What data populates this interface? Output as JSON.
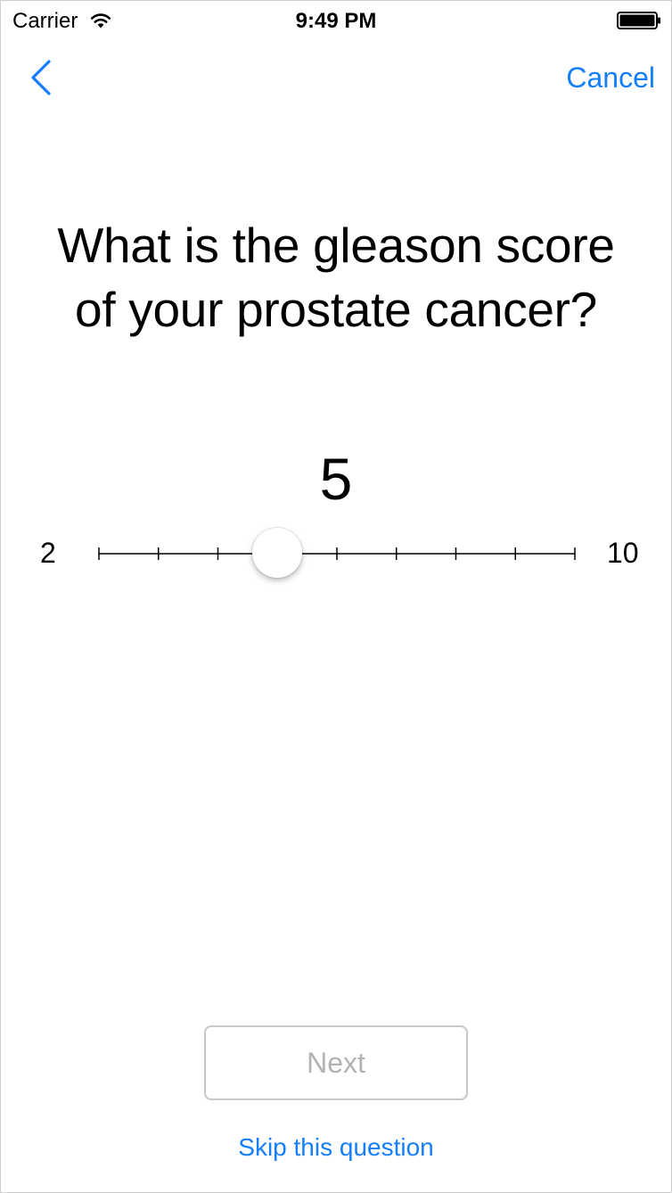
{
  "status_bar": {
    "carrier": "Carrier",
    "time": "9:49 PM",
    "wifi_icon": "wifi-icon",
    "battery_icon": "battery-full-icon"
  },
  "nav": {
    "back_icon": "chevron-left-icon",
    "cancel_label": "Cancel"
  },
  "question": {
    "line1": "What is the gleason score",
    "line2": "of your prostate cancer?"
  },
  "slider": {
    "value": "5",
    "min_label": "2",
    "max_label": "10",
    "min": 2,
    "max": 10,
    "current": 5,
    "step": 1
  },
  "footer": {
    "next_label": "Next",
    "skip_label": "Skip this question"
  },
  "colors": {
    "accent": "#147efb",
    "disabled_text": "#b3b3b3",
    "disabled_border": "#c7c7c7"
  }
}
